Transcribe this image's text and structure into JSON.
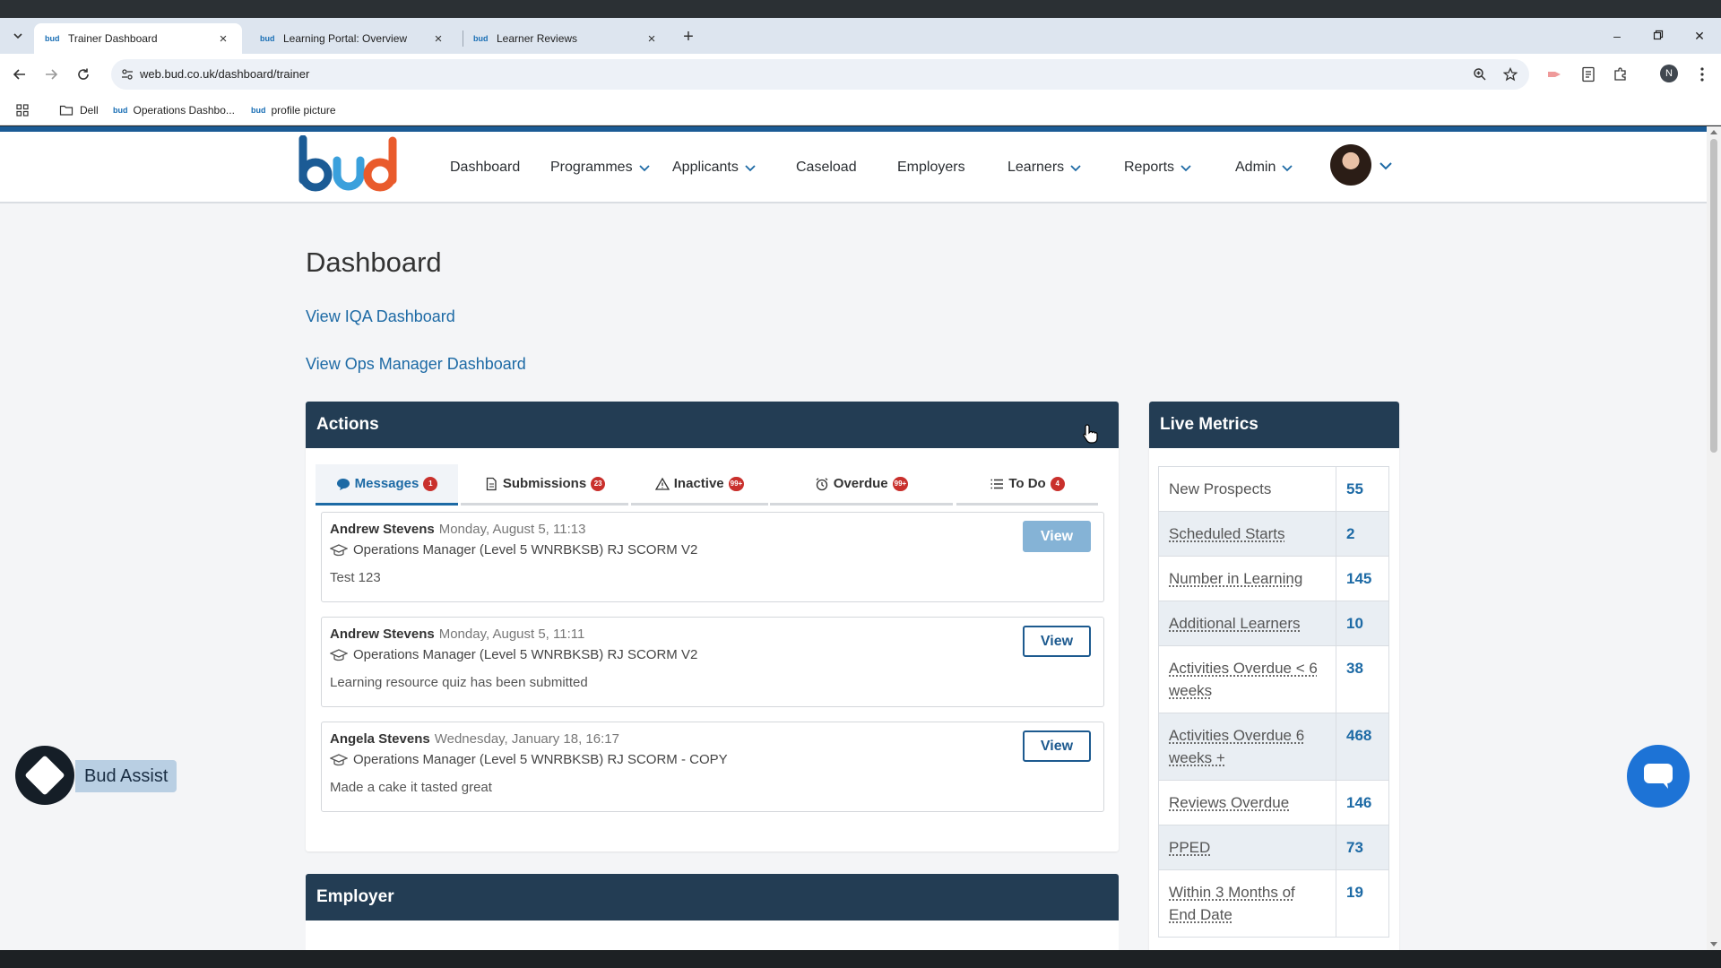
{
  "browser": {
    "tabs": [
      {
        "title": "Trainer Dashboard",
        "active": true
      },
      {
        "title": "Learning Portal: Overview",
        "active": false
      },
      {
        "title": "Learner Reviews",
        "active": false
      }
    ],
    "url": "web.bud.co.uk/dashboard/trainer",
    "profile_initial": "N",
    "bookmarks": [
      "Dell",
      "Operations Dashbo...",
      "profile picture"
    ]
  },
  "nav": {
    "items": [
      "Dashboard",
      "Programmes",
      "Applicants",
      "Caseload",
      "Employers",
      "Learners",
      "Reports",
      "Admin"
    ]
  },
  "page": {
    "title": "Dashboard",
    "links": [
      "View IQA Dashboard",
      "View Ops Manager Dashboard"
    ]
  },
  "actions": {
    "title": "Actions",
    "tabs": [
      {
        "label": "Messages",
        "badge": "1"
      },
      {
        "label": "Submissions",
        "badge": "23"
      },
      {
        "label": "Inactive",
        "badge": "99+"
      },
      {
        "label": "Overdue",
        "badge": "99+"
      },
      {
        "label": "To Do",
        "badge": "4"
      }
    ],
    "view_label": "View",
    "messages": [
      {
        "sender": "Andrew Stevens",
        "date": "Monday, August 5, 11:13",
        "course": "Operations Manager (Level 5 WNRBKSB) RJ SCORM V2",
        "body": "Test 123"
      },
      {
        "sender": "Andrew Stevens",
        "date": "Monday, August 5, 11:11",
        "course": "Operations Manager (Level 5 WNRBKSB) RJ SCORM V2",
        "body": "Learning resource quiz has been submitted"
      },
      {
        "sender": "Angela Stevens",
        "date": "Wednesday, January 18, 16:17",
        "course": "Operations Manager (Level 5 WNRBKSB) RJ SCORM - COPY",
        "body": "Made a cake it tasted great"
      }
    ]
  },
  "metrics": {
    "title": "Live Metrics",
    "rows": [
      {
        "label": "New Prospects",
        "value": "55"
      },
      {
        "label": "Scheduled Starts",
        "value": "2"
      },
      {
        "label": "Number in Learning",
        "value": "145"
      },
      {
        "label": "Additional Learners",
        "value": "10"
      },
      {
        "label": "Activities Overdue < 6 weeks",
        "value": "38"
      },
      {
        "label": "Activities Overdue 6 weeks +",
        "value": "468"
      },
      {
        "label": "Reviews Overdue",
        "value": "146"
      },
      {
        "label": "PPED",
        "value": "73"
      },
      {
        "label": "Within 3 Months of End Date",
        "value": "19"
      }
    ]
  },
  "employer": {
    "title": "Employer"
  },
  "assist": {
    "label": "Bud Assist"
  },
  "colors": {
    "header": "#233d54",
    "accent": "#1d6aa5",
    "badge": "#c9302c",
    "chat": "#1d73d6"
  }
}
